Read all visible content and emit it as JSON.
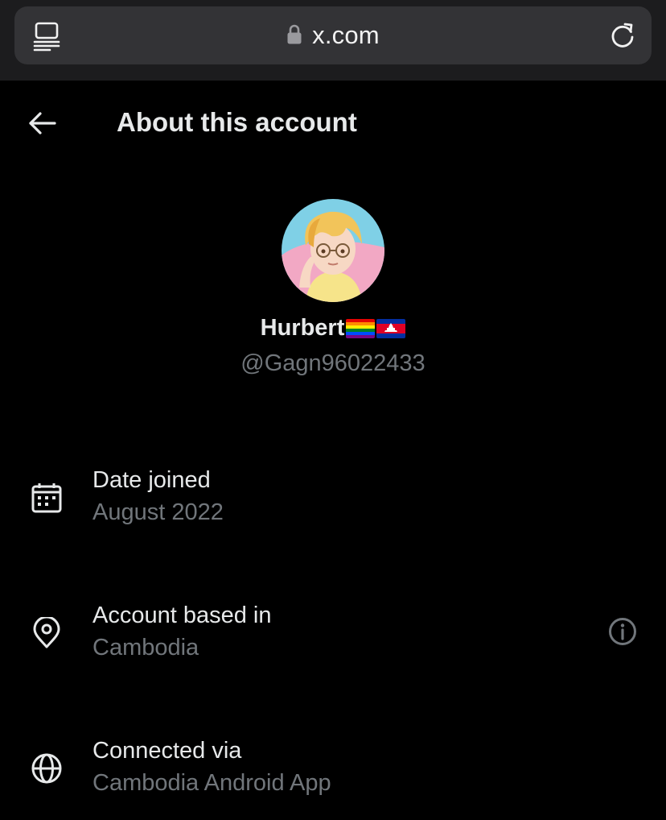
{
  "browser": {
    "url": "x.com"
  },
  "header": {
    "title": "About this account"
  },
  "profile": {
    "display_name": "Hurbert",
    "handle": "@Gagn96022433",
    "flags": [
      "rainbow-flag",
      "cambodia-flag"
    ]
  },
  "details": [
    {
      "icon": "calendar-icon",
      "label": "Date joined",
      "value": "August 2022"
    },
    {
      "icon": "location-pin-icon",
      "label": "Account based in",
      "value": "Cambodia"
    },
    {
      "icon": "globe-icon",
      "label": "Connected via",
      "value": "Cambodia Android App"
    }
  ],
  "colors": {
    "background": "#000000",
    "primary_text": "#e7e9ea",
    "secondary_text": "#71767b",
    "browser_bar": "#1c1c1e",
    "url_field": "#333336"
  }
}
